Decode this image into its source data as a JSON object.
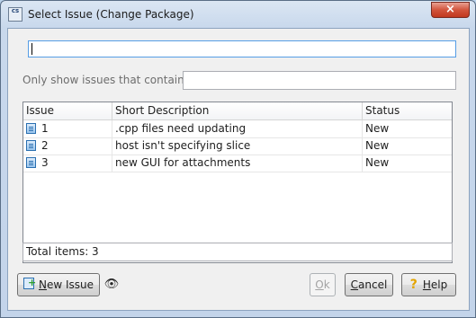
{
  "window": {
    "title": "Select Issue (Change Package)",
    "close_glyph": "×",
    "app_icon_text": "cs"
  },
  "search": {
    "value": ""
  },
  "filter": {
    "label": "Only show issues that contain:",
    "value": ""
  },
  "table": {
    "columns": [
      "Issue",
      "Short Description",
      "Status"
    ],
    "rows": [
      {
        "issue": "1",
        "description": ".cpp files need updating",
        "status": "New"
      },
      {
        "issue": "2",
        "description": "host isn't specifying slice",
        "status": "New"
      },
      {
        "issue": "3",
        "description": "new GUI for attachments",
        "status": "New"
      }
    ]
  },
  "footer": {
    "total_items": "Total items: 3"
  },
  "buttons": {
    "new_issue_mnemonic": "N",
    "new_issue_rest": "ew Issue",
    "find_glyph": "👁",
    "ok": "Ok",
    "ok_mnemonic": "O",
    "ok_rest": "k",
    "cancel_mnemonic": "C",
    "cancel_rest": "ancel",
    "help_glyph": "?",
    "help_mnemonic": "H",
    "help_rest": "elp"
  },
  "icons": {
    "app": "app-icon",
    "issue_row": "issue-icon",
    "new_issue": "new-issue-icon",
    "find": "binoculars-icon",
    "help": "help-bulb-icon"
  }
}
